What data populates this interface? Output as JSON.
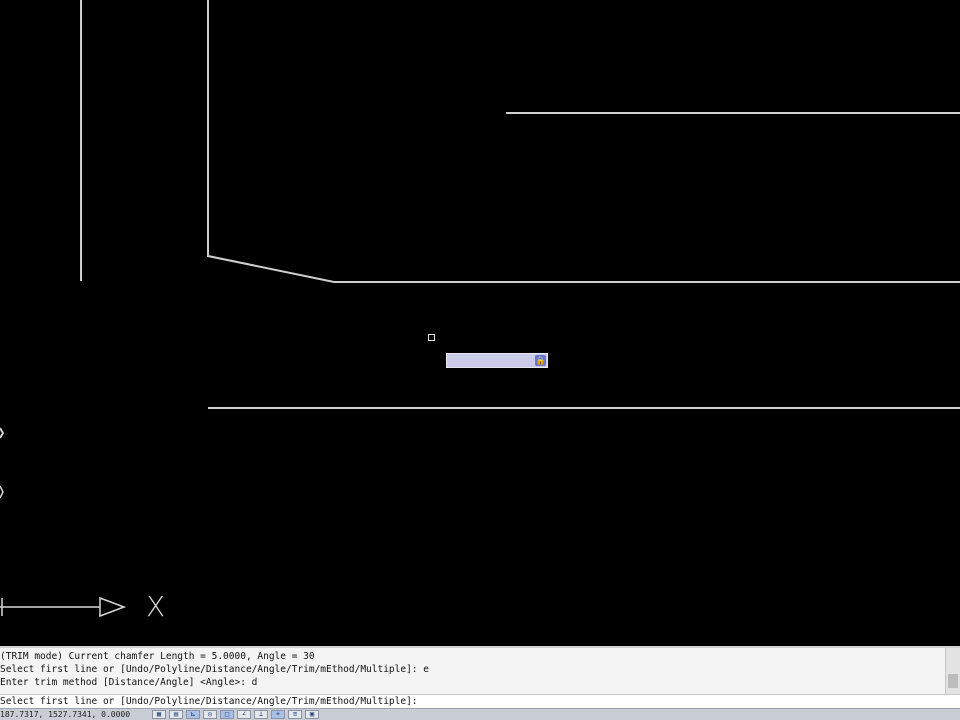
{
  "drawing": {
    "background_color": "#000000",
    "line_color": "#cfcfcf"
  },
  "ucs_icon": {
    "x_axis_label": "X"
  },
  "dynamic_input": {
    "value": "",
    "icon": "lock-icon",
    "highlight_color": "#c9cbe8"
  },
  "command_window": {
    "history": [
      "(TRIM mode) Current chamfer Length = 5.0000, Angle = 30",
      "Select first line or [Undo/Polyline/Distance/Angle/Trim/mEthod/Multiple]: e",
      "Enter trim method [Distance/Angle] <Angle>: d"
    ],
    "prompt": "Select first line or [Undo/Polyline/Distance/Angle/Trim/mEthod/Multiple]:"
  },
  "status_bar": {
    "coordinates": "187.7317, 1527.7341, 0.0000",
    "toggles": [
      {
        "name": "snap",
        "icon": "snap-icon",
        "glyph": "▦",
        "on": false
      },
      {
        "name": "grid",
        "icon": "grid-icon",
        "glyph": "▤",
        "on": false
      },
      {
        "name": "ortho",
        "icon": "ortho-icon",
        "glyph": "⊾",
        "on": true
      },
      {
        "name": "polar",
        "icon": "polar-icon",
        "glyph": "◎",
        "on": false
      },
      {
        "name": "osnap",
        "icon": "osnap-icon",
        "glyph": "□",
        "on": true
      },
      {
        "name": "otrack",
        "icon": "otrack-icon",
        "glyph": "∠",
        "on": false
      },
      {
        "name": "ducs",
        "icon": "ducs-icon",
        "glyph": "⊥",
        "on": false
      },
      {
        "name": "dyn",
        "icon": "dyn-icon",
        "glyph": "+",
        "on": true
      },
      {
        "name": "lwt",
        "icon": "lineweight-icon",
        "glyph": "≡",
        "on": false
      },
      {
        "name": "model",
        "icon": "model-icon",
        "glyph": "▣",
        "on": false
      }
    ]
  }
}
